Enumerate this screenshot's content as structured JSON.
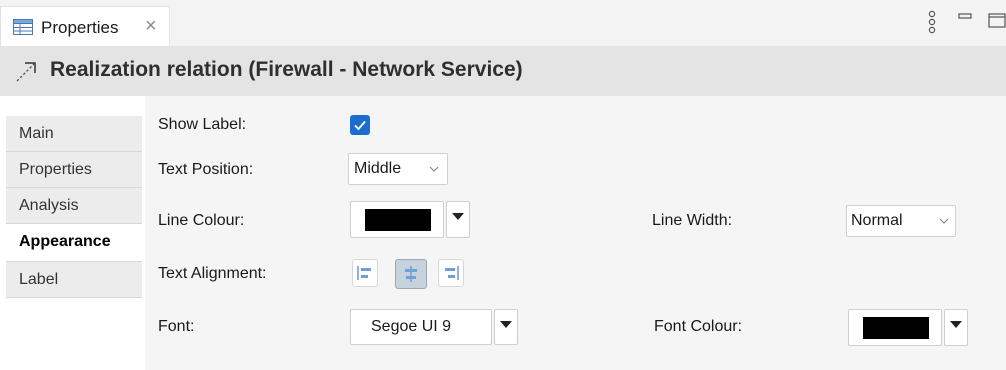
{
  "tab": {
    "label": "Properties",
    "close": "×"
  },
  "title": {
    "text": "Realization relation (Firewall - Network Service)"
  },
  "nav": {
    "items": [
      {
        "label": "Main",
        "active": false
      },
      {
        "label": "Properties",
        "active": false
      },
      {
        "label": "Analysis",
        "active": false
      },
      {
        "label": "Appearance",
        "active": true
      },
      {
        "label": "Label",
        "active": false
      }
    ]
  },
  "form": {
    "show_label": {
      "label": "Show Label:",
      "checked": true
    },
    "text_position": {
      "label": "Text Position:",
      "value": "Middle"
    },
    "line_colour": {
      "label": "Line Colour:",
      "color": "#000000"
    },
    "line_width": {
      "label": "Line Width:",
      "value": "Normal"
    },
    "text_alignment": {
      "label": "Text Alignment:",
      "options": [
        "left",
        "center",
        "right"
      ],
      "selected": "center"
    },
    "font": {
      "label": "Font:",
      "value": "Segoe UI 9"
    },
    "font_colour": {
      "label": "Font Colour:",
      "color": "#000000"
    }
  },
  "colors": {
    "accent": "#1c6dd0",
    "title_bar": "#e4e4e4",
    "content_bg": "#f5f5f5"
  }
}
